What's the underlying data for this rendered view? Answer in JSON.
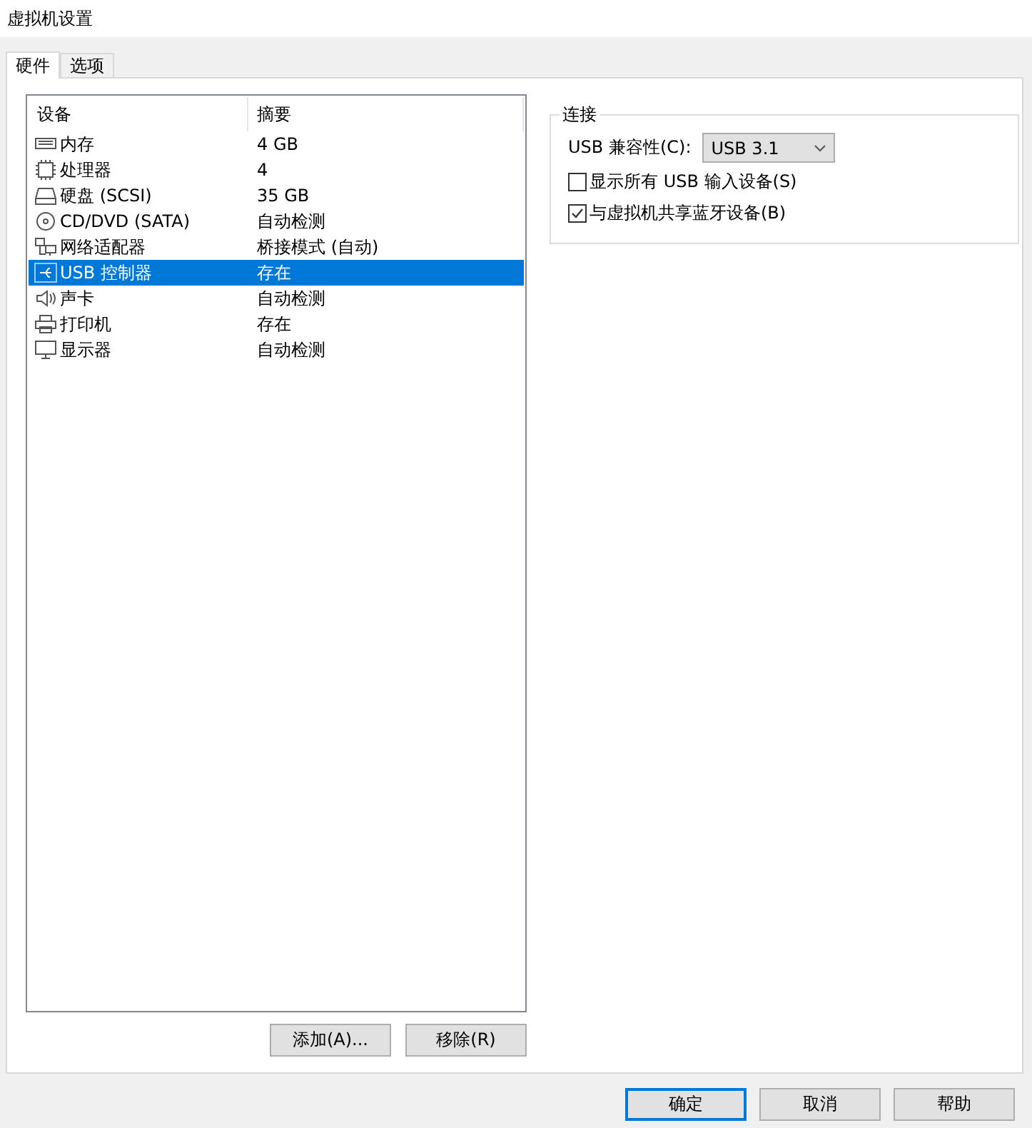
{
  "window": {
    "title": "虚拟机设置"
  },
  "tabs": [
    {
      "label": "硬件",
      "selected": true
    },
    {
      "label": "选项",
      "selected": false
    }
  ],
  "device_list": {
    "columns": [
      "设备",
      "摘要"
    ],
    "rows": [
      {
        "kind": "memory",
        "device": "内存",
        "summary": "4 GB",
        "selected": false
      },
      {
        "kind": "cpu",
        "device": "处理器",
        "summary": "4",
        "selected": false
      },
      {
        "kind": "disk",
        "device": "硬盘 (SCSI)",
        "summary": "35 GB",
        "selected": false
      },
      {
        "kind": "cdrom",
        "device": "CD/DVD (SATA)",
        "summary": "自动检测",
        "selected": false
      },
      {
        "kind": "network",
        "device": "网络适配器",
        "summary": "桥接模式 (自动)",
        "selected": false
      },
      {
        "kind": "usb",
        "device": "USB 控制器",
        "summary": "存在",
        "selected": true
      },
      {
        "kind": "sound",
        "device": "声卡",
        "summary": "自动检测",
        "selected": false
      },
      {
        "kind": "printer",
        "device": "打印机",
        "summary": "存在",
        "selected": false
      },
      {
        "kind": "display",
        "device": "显示器",
        "summary": "自动检测",
        "selected": false
      }
    ],
    "buttons": [
      "添加(A)...",
      "移除(R)"
    ]
  },
  "connection": {
    "title": "连接",
    "compat_label": "USB 兼容性(C):",
    "compat_value": "USB 3.1",
    "options": [
      {
        "label": "显示所有 USB 输入设备(S)",
        "checked": false
      },
      {
        "label": "与虚拟机共享蓝牙设备(B)",
        "checked": true
      }
    ]
  },
  "buttons": [
    {
      "label": "确定",
      "default": true
    },
    {
      "label": "取消",
      "default": false
    },
    {
      "label": "帮助",
      "default": false
    }
  ]
}
